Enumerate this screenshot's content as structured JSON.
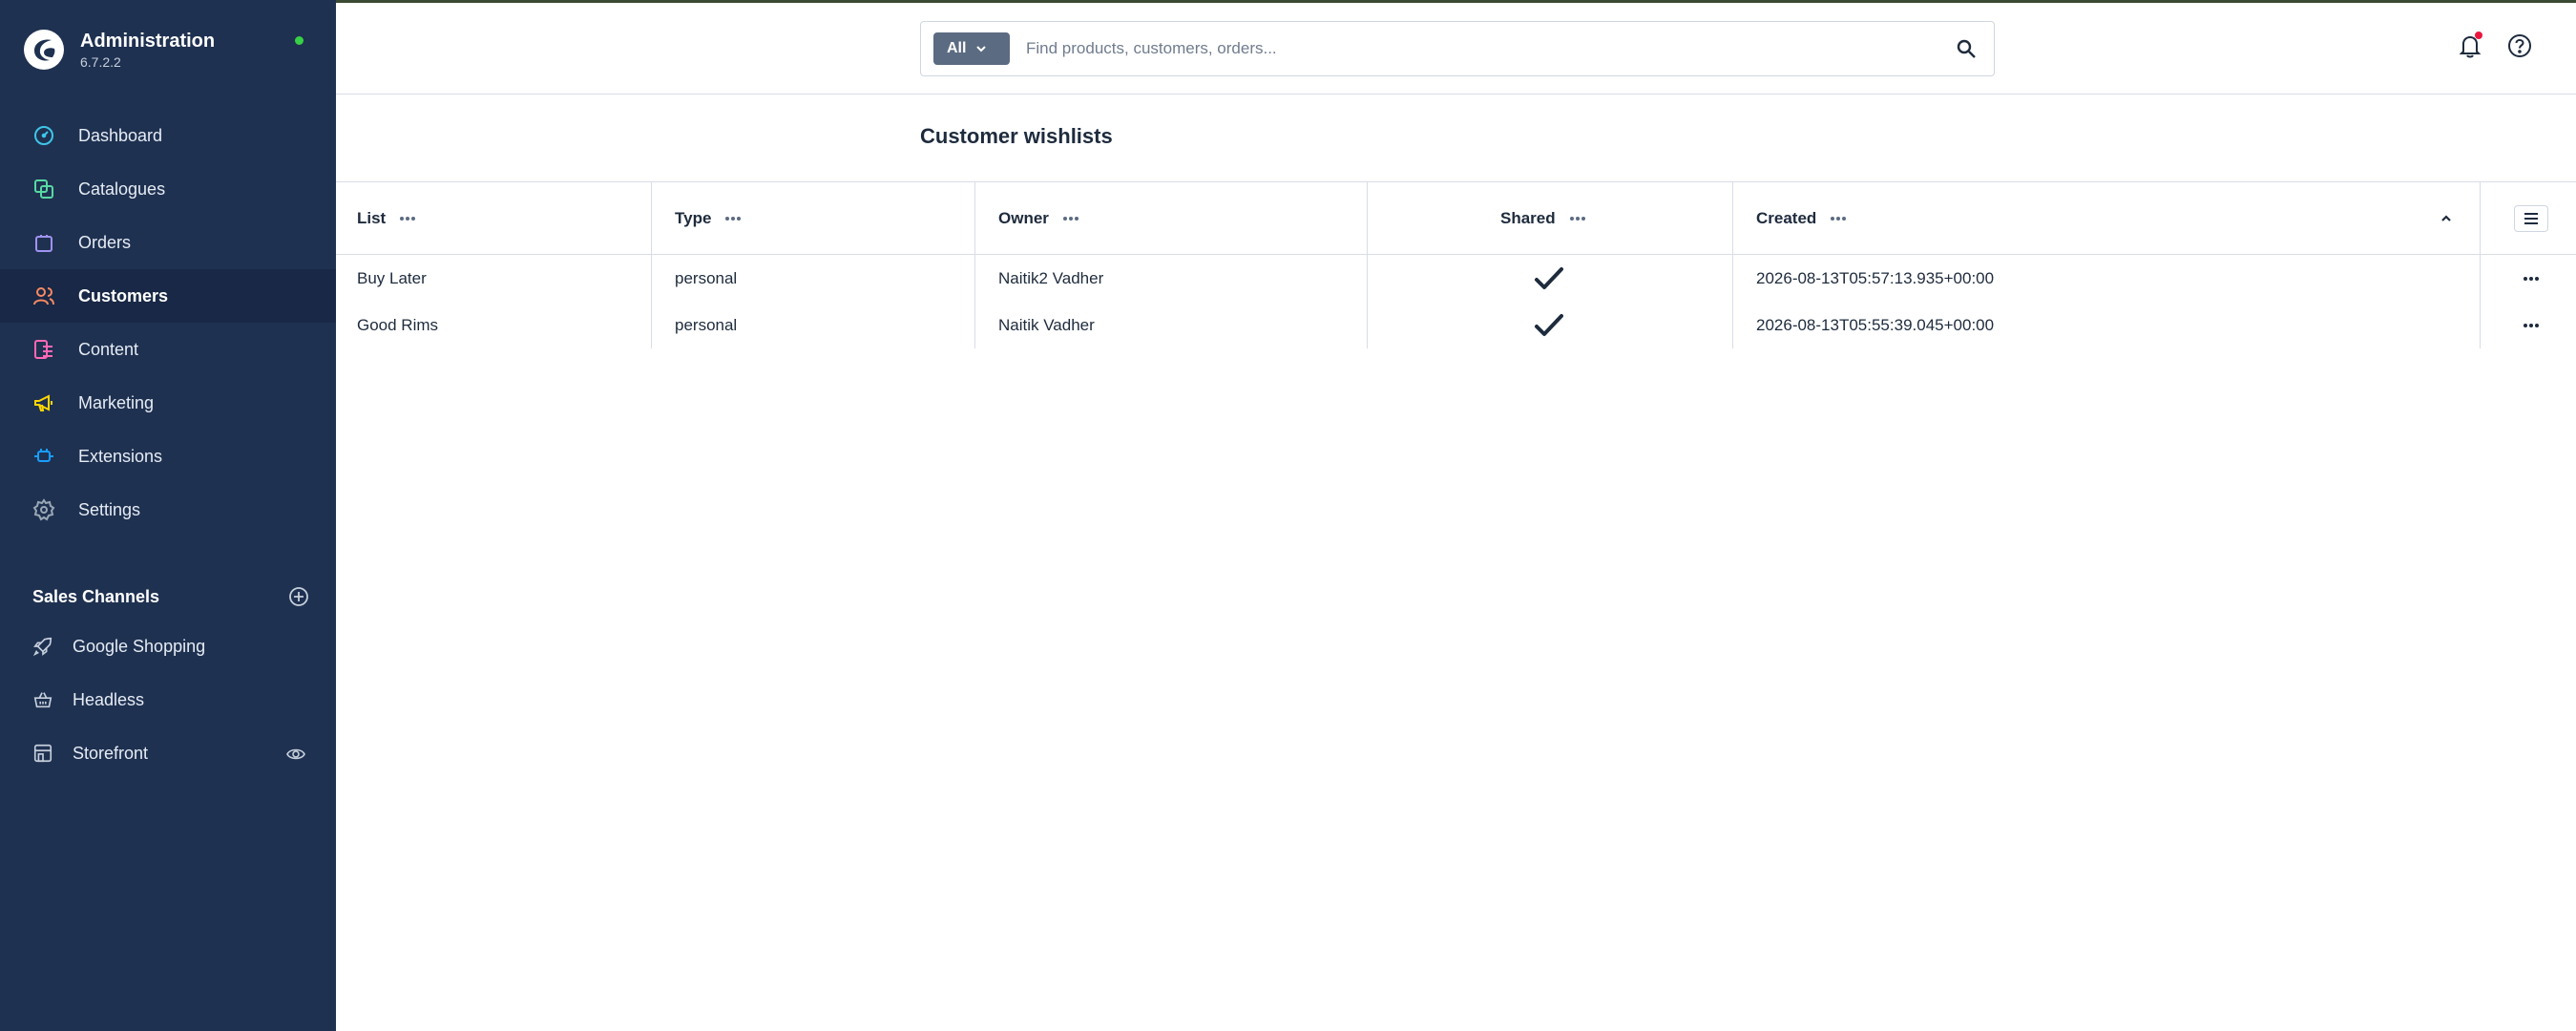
{
  "app": {
    "name": "Administration",
    "version": "6.7.2.2"
  },
  "nav": [
    {
      "label": "Dashboard",
      "icon": "dashboard-icon",
      "color": "#3ec6e8"
    },
    {
      "label": "Catalogues",
      "icon": "catalogues-icon",
      "color": "#57d9a3"
    },
    {
      "label": "Orders",
      "icon": "orders-icon",
      "color": "#a092f0"
    },
    {
      "label": "Customers",
      "icon": "customers-icon",
      "color": "#f88962"
    },
    {
      "label": "Content",
      "icon": "content-icon",
      "color": "#ff68b4"
    },
    {
      "label": "Marketing",
      "icon": "marketing-icon",
      "color": "#ffd700"
    },
    {
      "label": "Extensions",
      "icon": "extensions-icon",
      "color": "#189eff"
    },
    {
      "label": "Settings",
      "icon": "settings-icon",
      "color": "#9aa8b5"
    }
  ],
  "active_nav": "Customers",
  "sales_channels": {
    "title": "Sales Channels",
    "items": [
      {
        "label": "Google Shopping",
        "icon": "rocket-icon"
      },
      {
        "label": "Headless",
        "icon": "basket-icon"
      },
      {
        "label": "Storefront",
        "icon": "storefront-icon"
      }
    ]
  },
  "search": {
    "type_label": "All",
    "placeholder": "Find products, customers, orders..."
  },
  "page": {
    "title": "Customer wishlists"
  },
  "table": {
    "columns": [
      "List",
      "Type",
      "Owner",
      "Shared",
      "Created"
    ],
    "rows": [
      {
        "list": "Buy Later",
        "type": "personal",
        "owner": "Naitik2 Vadher",
        "shared": true,
        "created": "2026-08-13T05:57:13.935+00:00"
      },
      {
        "list": "Good Rims",
        "type": "personal",
        "owner": "Naitik Vadher",
        "shared": true,
        "created": "2026-08-13T05:55:39.045+00:00"
      }
    ]
  }
}
